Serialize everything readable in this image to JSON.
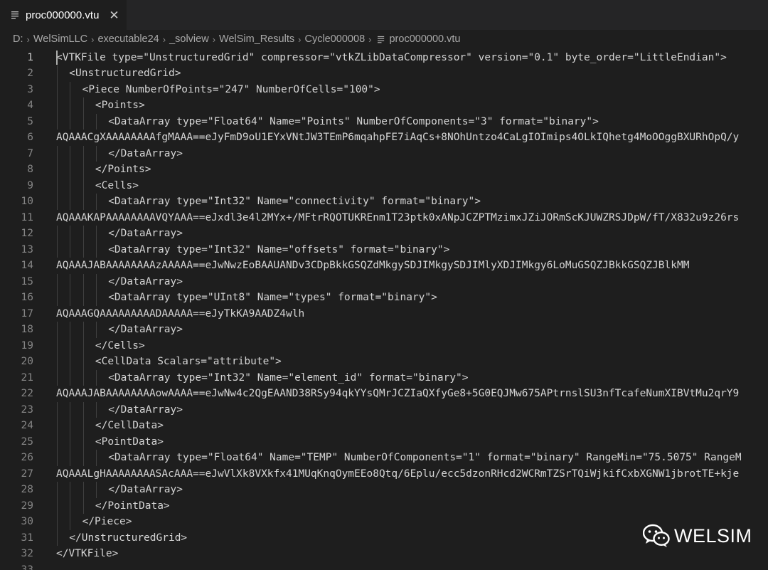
{
  "tab": {
    "label": "proc000000.vtu",
    "close_glyph": "✕",
    "icon": "lines-file-icon"
  },
  "breadcrumb": {
    "items": [
      "D:",
      "WelSimLLC",
      "executable24",
      "_solview",
      "WelSim_Results",
      "Cycle000008"
    ],
    "file": "proc000000.vtu",
    "separator": "›"
  },
  "editor": {
    "active_line": 1,
    "lines": [
      {
        "n": "1",
        "indent": 0,
        "text": "<VTKFile type=\"UnstructuredGrid\" compressor=\"vtkZLibDataCompressor\" version=\"0.1\" byte_order=\"LittleEndian\">"
      },
      {
        "n": "2",
        "indent": 1,
        "text": "<UnstructuredGrid>"
      },
      {
        "n": "3",
        "indent": 2,
        "text": "<Piece NumberOfPoints=\"247\" NumberOfCells=\"100\">"
      },
      {
        "n": "4",
        "indent": 3,
        "text": "<Points>"
      },
      {
        "n": "5",
        "indent": 4,
        "text": "<DataArray type=\"Float64\" Name=\"Points\" NumberOfComponents=\"3\" format=\"binary\">"
      },
      {
        "n": "6",
        "indent": 0,
        "text": "AQAAACgXAAAAAAAAfgMAAA==eJyFmD9oU1EYxVNtJW3TEmP6mqahpFE7iAqCs+8NOhUntzo4CaLgIOImips4OLkIQhetg4MoOOggBXURhOpQ/y"
      },
      {
        "n": "7",
        "indent": 4,
        "text": "</DataArray>"
      },
      {
        "n": "8",
        "indent": 3,
        "text": "</Points>"
      },
      {
        "n": "9",
        "indent": 3,
        "text": "<Cells>"
      },
      {
        "n": "10",
        "indent": 4,
        "text": "<DataArray type=\"Int32\" Name=\"connectivity\" format=\"binary\">"
      },
      {
        "n": "11",
        "indent": 0,
        "text": "AQAAAKAPAAAAAAAAVQYAAA==eJxdl3e4l2MYx+/MFtrRQOTUKREnm1T23ptk0xANpJCZPTMzimxJZiJORmScKJUWZRSJDpW/fT/X832u9z26rs"
      },
      {
        "n": "12",
        "indent": 4,
        "text": "</DataArray>"
      },
      {
        "n": "13",
        "indent": 4,
        "text": "<DataArray type=\"Int32\" Name=\"offsets\" format=\"binary\">"
      },
      {
        "n": "14",
        "indent": 0,
        "text": "AQAAAJABAAAAAAAAzAAAAA==eJwNwzEoBAAUANDv3CDpBkkGSQZdMkgySDJIMkgySDJIMlyXDJIMkgy6LoMuGSQZJBkkGSQZJBlkMM"
      },
      {
        "n": "15",
        "indent": 4,
        "text": "</DataArray>"
      },
      {
        "n": "16",
        "indent": 4,
        "text": "<DataArray type=\"UInt8\" Name=\"types\" format=\"binary\">"
      },
      {
        "n": "17",
        "indent": 0,
        "text": "AQAAAGQAAAAAAAAADAAAAA==eJyTkKA9AADZ4wlh"
      },
      {
        "n": "18",
        "indent": 4,
        "text": "</DataArray>"
      },
      {
        "n": "19",
        "indent": 3,
        "text": "</Cells>"
      },
      {
        "n": "20",
        "indent": 3,
        "text": "<CellData Scalars=\"attribute\">"
      },
      {
        "n": "21",
        "indent": 4,
        "text": "<DataArray type=\"Int32\" Name=\"element_id\" format=\"binary\">"
      },
      {
        "n": "22",
        "indent": 0,
        "text": "AQAAAJABAAAAAAAAowAAAA==eJwNw4c2QgEAAND38RSy94qkYYsQMrJCZIaQXfyGe8+5G0EQJMw675APtrnslSU3nfTcafeNumXIBVtMu2qrY9"
      },
      {
        "n": "23",
        "indent": 4,
        "text": "</DataArray>"
      },
      {
        "n": "24",
        "indent": 3,
        "text": "</CellData>"
      },
      {
        "n": "25",
        "indent": 3,
        "text": "<PointData>"
      },
      {
        "n": "26",
        "indent": 4,
        "text": "<DataArray type=\"Float64\" Name=\"TEMP\" NumberOfComponents=\"1\" format=\"binary\" RangeMin=\"75.5075\" RangeM"
      },
      {
        "n": "27",
        "indent": 0,
        "text": "AQAAALgHAAAAAAAASAcAAA==eJwVlXk8VXkfx41MUqKnqOymEEo8Qtq/6Eplu/ecc5dzonRHcd2WCRmTZSrTQiWjkifCxbXGNW1jbrotTE+kje"
      },
      {
        "n": "28",
        "indent": 4,
        "text": "</DataArray>"
      },
      {
        "n": "29",
        "indent": 3,
        "text": "</PointData>"
      },
      {
        "n": "30",
        "indent": 2,
        "text": "</Piece>"
      },
      {
        "n": "31",
        "indent": 1,
        "text": "</UnstructuredGrid>"
      },
      {
        "n": "32",
        "indent": 0,
        "text": "</VTKFile>"
      },
      {
        "n": "33",
        "indent": 0,
        "text": ""
      }
    ]
  },
  "watermark": {
    "text": "WELSIM",
    "icon": "wechat-logo-icon"
  },
  "colors": {
    "background": "#1e1e1e",
    "tabbar": "#252526",
    "line_number": "#858585",
    "text": "#d4d4d4"
  }
}
